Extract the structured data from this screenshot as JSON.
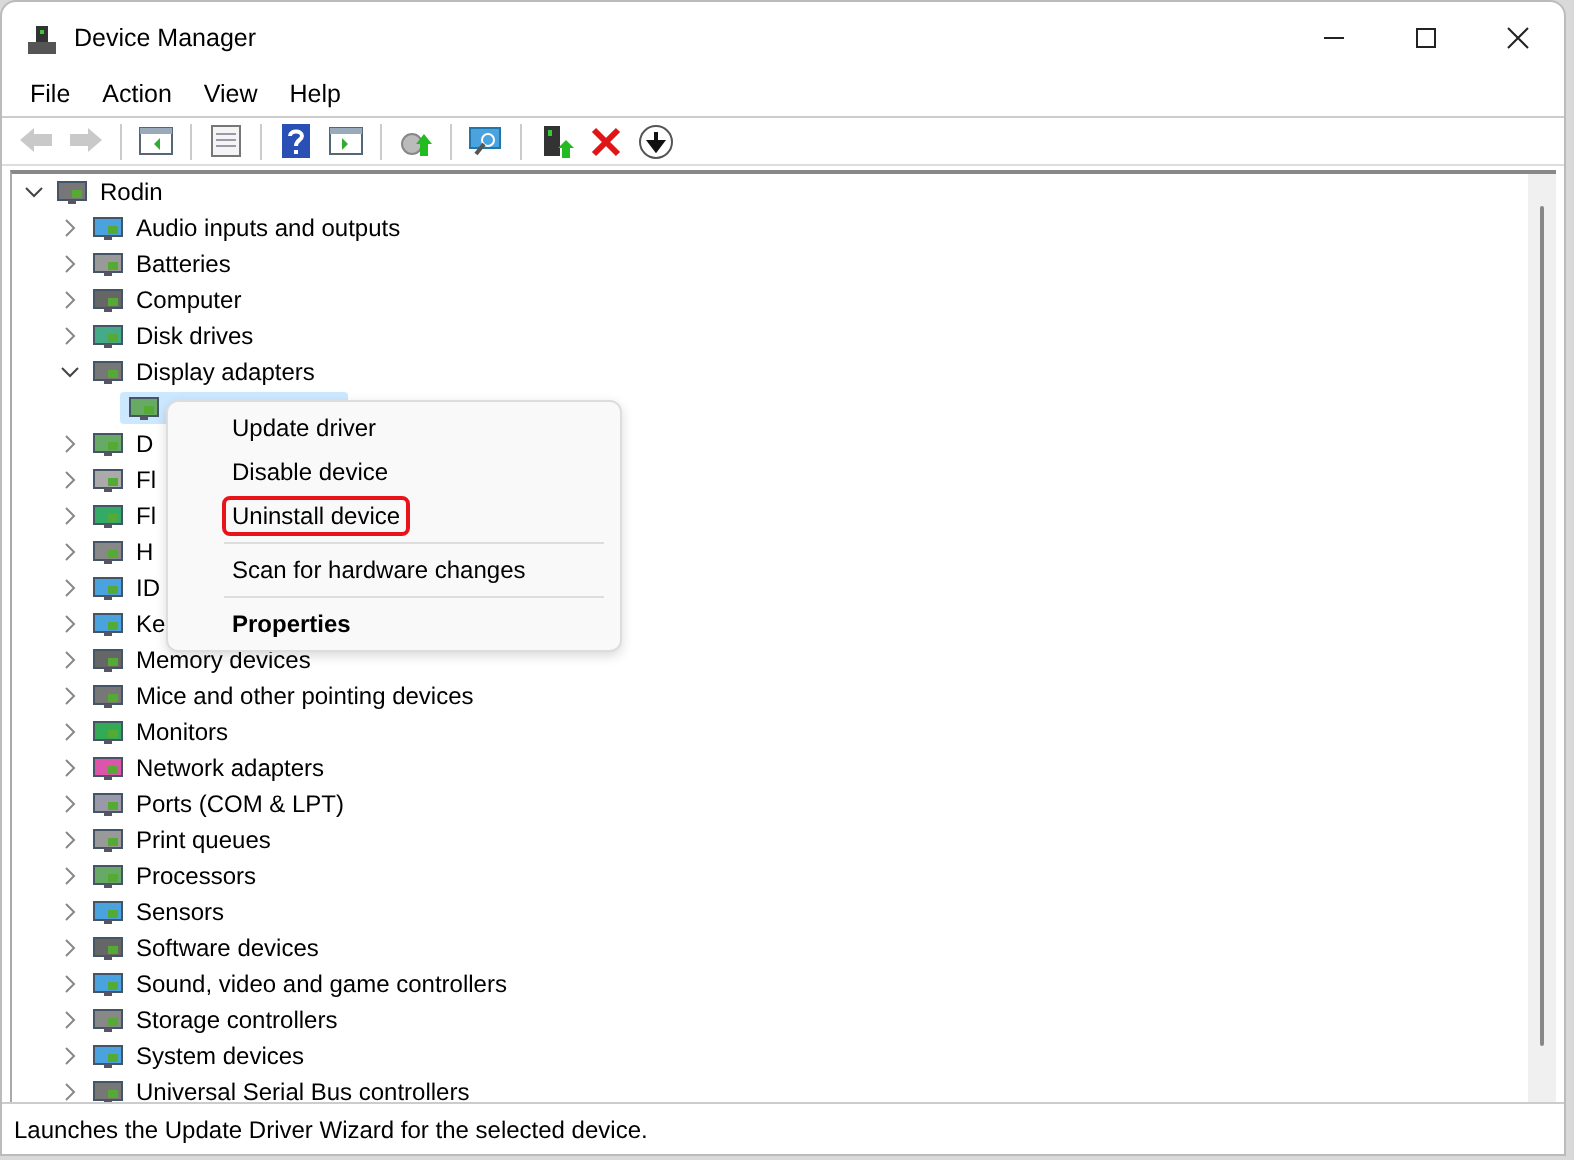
{
  "window": {
    "title": "Device Manager"
  },
  "menu_bar": [
    "File",
    "Action",
    "View",
    "Help"
  ],
  "toolbar": [
    {
      "kind": "back",
      "disabled": true
    },
    {
      "kind": "forward",
      "disabled": true
    },
    {
      "kind": "sep"
    },
    {
      "kind": "tree"
    },
    {
      "kind": "sep"
    },
    {
      "kind": "props"
    },
    {
      "kind": "sep"
    },
    {
      "kind": "help"
    },
    {
      "kind": "run"
    },
    {
      "kind": "sep"
    },
    {
      "kind": "update"
    },
    {
      "kind": "sep"
    },
    {
      "kind": "scan"
    },
    {
      "kind": "sep"
    },
    {
      "kind": "add"
    },
    {
      "kind": "uninstall"
    },
    {
      "kind": "disable"
    }
  ],
  "tree": {
    "label": "Rodin",
    "expanded": true,
    "children": [
      {
        "label": "Audio inputs and outputs",
        "expanded": false
      },
      {
        "label": "Batteries",
        "expanded": false
      },
      {
        "label": "Computer",
        "expanded": false
      },
      {
        "label": "Disk drives",
        "expanded": false
      },
      {
        "label": "Display adapters",
        "expanded": true,
        "children": [
          {
            "selected": true
          }
        ]
      },
      {
        "label": "D",
        "expanded": false
      },
      {
        "label": "Fl",
        "expanded": false
      },
      {
        "label": "Fl",
        "expanded": false
      },
      {
        "label": "H",
        "expanded": false
      },
      {
        "label": "ID",
        "expanded": false
      },
      {
        "label": "Ke",
        "expanded": false
      },
      {
        "label": "Memory devices",
        "expanded": false
      },
      {
        "label": "Mice and other pointing devices",
        "expanded": false
      },
      {
        "label": "Monitors",
        "expanded": false
      },
      {
        "label": "Network adapters",
        "expanded": false
      },
      {
        "label": "Ports (COM & LPT)",
        "expanded": false
      },
      {
        "label": "Print queues",
        "expanded": false
      },
      {
        "label": "Processors",
        "expanded": false
      },
      {
        "label": "Sensors",
        "expanded": false
      },
      {
        "label": "Software devices",
        "expanded": false
      },
      {
        "label": "Sound, video and game controllers",
        "expanded": false
      },
      {
        "label": "Storage controllers",
        "expanded": false
      },
      {
        "label": "System devices",
        "expanded": false
      },
      {
        "label": "Universal Serial Bus controllers",
        "expanded": false
      }
    ]
  },
  "context_menu": [
    {
      "kind": "item",
      "label": "Update driver",
      "bold": false,
      "highlighted": false
    },
    {
      "kind": "item",
      "label": "Disable device",
      "bold": false,
      "highlighted": false
    },
    {
      "kind": "item",
      "label": "Uninstall device",
      "bold": false,
      "highlighted": true
    },
    {
      "kind": "separator"
    },
    {
      "kind": "item",
      "label": "Scan for hardware changes",
      "bold": false,
      "highlighted": false
    },
    {
      "kind": "separator"
    },
    {
      "kind": "item",
      "label": "Properties",
      "bold": true,
      "highlighted": false
    }
  ],
  "status_bar": "Launches the Update Driver Wizard for the selected device."
}
